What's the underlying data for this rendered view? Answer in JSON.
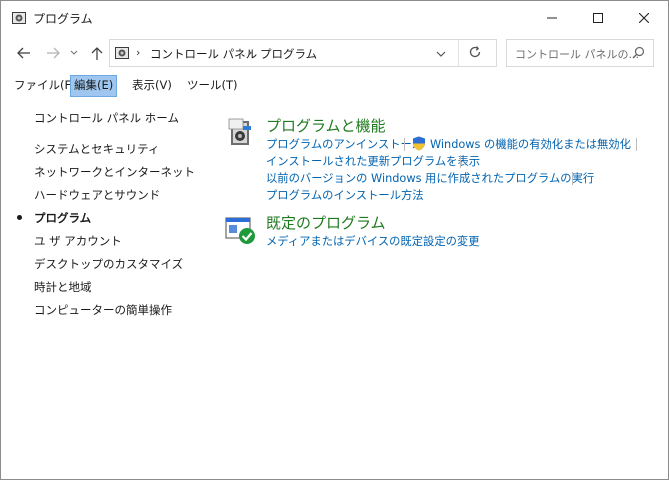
{
  "window": {
    "title": "プログラム"
  },
  "address": {
    "crumbs": [
      "コントロール パネル",
      "プログラム"
    ]
  },
  "search": {
    "placeholder": "コントロール パネルの..."
  },
  "menubar": {
    "items": [
      "ファイル(F)",
      "編集(E)",
      "表示(V)",
      "ツール(T)"
    ],
    "active_index": 1
  },
  "sidebar": {
    "items": [
      {
        "label": "コントロール パネル ホーム"
      },
      {
        "label": "システムとセキュリティ"
      },
      {
        "label": "ネットワークとインターネット"
      },
      {
        "label": "ハードウェアとサウンド"
      },
      {
        "label": "プログラム",
        "current": true
      },
      {
        "label": "ユ ザ アカウント"
      },
      {
        "label": "デスクトップのカスタマイズ"
      },
      {
        "label": "時計と地域"
      },
      {
        "label": "コンピューターの簡単操作"
      }
    ]
  },
  "categories": [
    {
      "title": "プログラムと機能",
      "icon": "programs-features-icon",
      "links": [
        "プログラムのアンインストール",
        "Windows の機能の有効化または無効化",
        "インストールされた更新プログラムを表示",
        "以前のバージョンの Windows 用に作成されたプログラムの実行",
        "プログラムのインストール方法"
      ]
    },
    {
      "title": "既定のプログラム",
      "icon": "default-programs-icon",
      "links": [
        "メディアまたはデバイスの既定設定の変更"
      ]
    }
  ],
  "colors": {
    "link": "#0063b1",
    "category_title": "#1f7a1f",
    "menu_active": "#9ec6ee"
  }
}
